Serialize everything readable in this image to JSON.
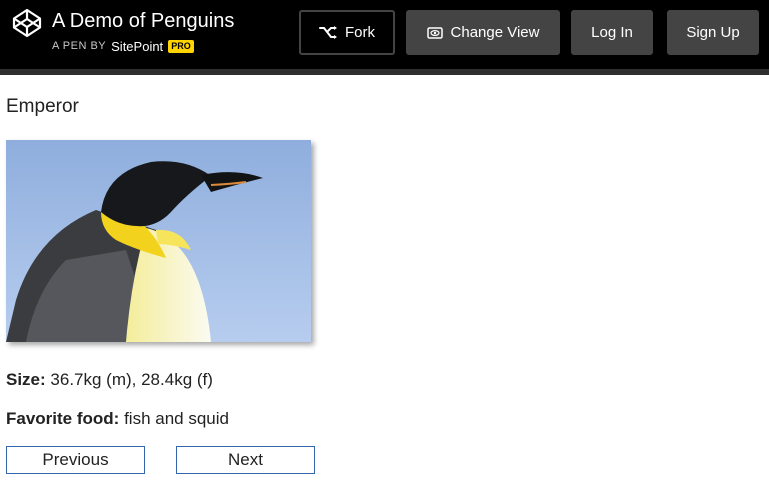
{
  "header": {
    "title": "A Demo of Penguins",
    "byline_prefix": "A PEN BY",
    "author": "SitePoint",
    "badge": "PRO",
    "buttons": {
      "fork": "Fork",
      "change_view": "Change View",
      "login": "Log In",
      "signup": "Sign Up"
    },
    "icons": {
      "logo": "codepen-logo-icon",
      "fork": "fork-icon",
      "change_view": "eye-icon"
    }
  },
  "penguin": {
    "name": "Emperor",
    "size_label": "Size:",
    "size_value": " 36.7kg (m), 28.4kg (f)",
    "food_label": "Favorite food:",
    "food_value": " fish and squid"
  },
  "navigation": {
    "previous": "Previous",
    "next": "Next"
  },
  "colors": {
    "header_bg": "#000000",
    "button_bg": "#444444",
    "badge": "#ffd400",
    "nav_border": "#3366aa"
  }
}
